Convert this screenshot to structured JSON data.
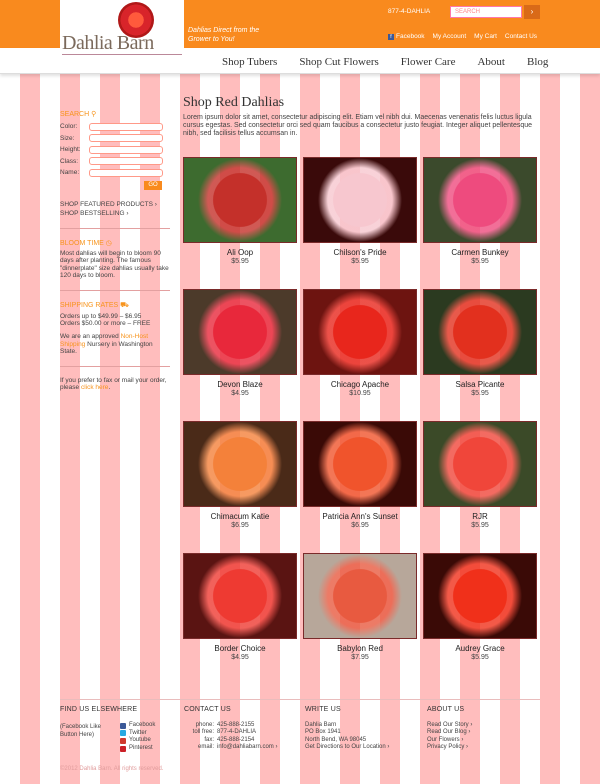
{
  "header": {
    "logo_text": "Dahlia Barn",
    "tagline": "Dahlias Direct from the Grower to You!",
    "phone": "877-4-DAHLIA",
    "search_placeholder": "SEARCH",
    "search_button": "›",
    "links": [
      "Facebook",
      "My Account",
      "My Cart",
      "Contact Us"
    ],
    "color": "#f98a1e"
  },
  "nav": [
    "Shop Tubers",
    "Shop Cut Flowers",
    "Flower Care",
    "About",
    "Blog"
  ],
  "sidebar": {
    "search_heading": "SEARCH",
    "fields": [
      "Color:",
      "Size:",
      "Height:",
      "Class:",
      "Name:"
    ],
    "go": "GO",
    "links": [
      "SHOP FEATURED PRODUCTS ›",
      "SHOP BESTSELLING ›"
    ],
    "bloom_heading": "BLOOM TIME",
    "bloom_text": "Most dahlias will begin to bloom 90 days after planting. The famous \"dinnerplate\" size dahlias usually take 120 days to bloom.",
    "shipping_heading": "SHIPPING RATES",
    "ship1": "Orders up to $49.99 – $6.95",
    "ship2": "Orders $50.00 or more – FREE",
    "approved_pre": "We are an approved ",
    "approved_link": "Non-Host Shipping",
    "approved_post": " Nursery in Washington State.",
    "fax_pre": "If you prefer to fax or mail your order, please ",
    "fax_link": "click here",
    "fax_post": "."
  },
  "main": {
    "title": "Shop Red Dahlias",
    "intro": "Lorem ipsum dolor sit amet, consectetur adipiscing elit. Etiam vel nibh dui. Maecenas venenatis felis luctus ligula cursus egestas. Sed consectetur orci sed quam faucibus a consectetur justo feugiat. Integer aliquet pellentesque nibh, sed facilisis tellus accumsan in."
  },
  "products": [
    {
      "name": "Ali Oop",
      "price": "$5.95",
      "colors": [
        "#c4302a",
        "#3d6b2f"
      ]
    },
    {
      "name": "Chilson's Pride",
      "price": "$5.95",
      "colors": [
        "#f7c7cf",
        "#3a0a0a"
      ]
    },
    {
      "name": "Carmen Bunkey",
      "price": "$5.95",
      "colors": [
        "#ee4b7e",
        "#3b4a2c"
      ]
    },
    {
      "name": "Devon Blaze",
      "price": "$4.95",
      "colors": [
        "#e8283b",
        "#4c3a2a"
      ]
    },
    {
      "name": "Chicago Apache",
      "price": "$10.95",
      "colors": [
        "#e8261c",
        "#6d1410"
      ]
    },
    {
      "name": "Salsa Picante",
      "price": "$5.95",
      "colors": [
        "#e2301e",
        "#2b3a20"
      ]
    },
    {
      "name": "Chimacum Katie",
      "price": "$6.95",
      "colors": [
        "#f4813a",
        "#4a2a18"
      ]
    },
    {
      "name": "Patricia Ann's Sunset",
      "price": "$6.95",
      "colors": [
        "#f0542c",
        "#3a0a06"
      ]
    },
    {
      "name": "RJR",
      "price": "$5.95",
      "colors": [
        "#f0463a",
        "#3b4a28"
      ]
    },
    {
      "name": "Border Choice",
      "price": "$4.95",
      "colors": [
        "#ee3a32",
        "#5a1412"
      ]
    },
    {
      "name": "Babylon Red",
      "price": "$7.95",
      "colors": [
        "#e85a40",
        "#b7a79a"
      ]
    },
    {
      "name": "Audrey Grace",
      "price": "$5.95",
      "colors": [
        "#f0301a",
        "#3a0a06"
      ]
    }
  ],
  "footer": {
    "find_heading": "FIND US ELSEWHERE",
    "fb_like": "(Facebook Like Button Here)",
    "social": [
      "Facebook",
      "Twitter",
      "Youtube",
      "Pinterest"
    ],
    "social_colors": [
      "#3b5998",
      "#29a9e1",
      "#d03a2e",
      "#cb2027"
    ],
    "contact_heading": "CONTACT US",
    "contact_rows": [
      [
        "phone:",
        "425-888-2155"
      ],
      [
        "toll free:",
        "877-4-DAHLIA"
      ],
      [
        "fax:",
        "425-888-2154"
      ],
      [
        "email:",
        "info@dahliabarn.com ›"
      ]
    ],
    "write_heading": "WRITE US",
    "write_lines": [
      "Dahlia Barn",
      "PO Box 1941",
      "North Bend, WA 98045",
      "Get Directions to Our Location ›"
    ],
    "about_heading": "ABOUT US",
    "about_lines": [
      "Read Our Story ›",
      "Read Our Blog ›",
      "Our Flowers ›",
      "Privacy Policy ›"
    ],
    "copyright": "©2012 Dahlia Barn. All rights reserved."
  }
}
